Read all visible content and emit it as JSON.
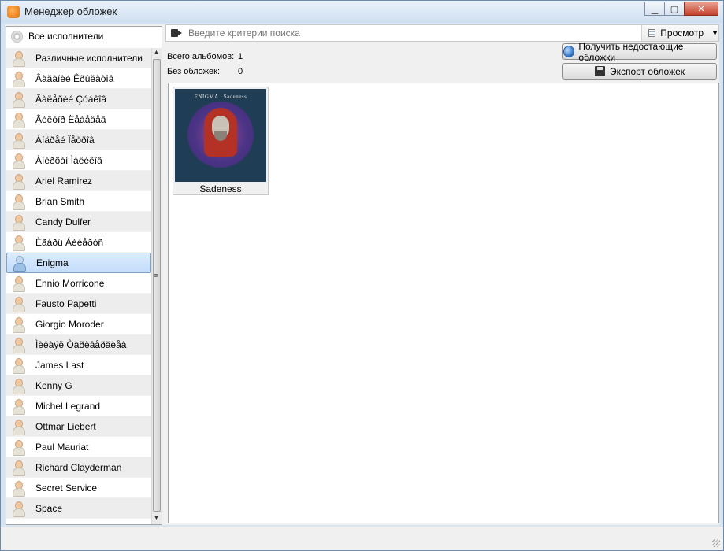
{
  "window": {
    "title": "Менеджер обложек",
    "buttons": {
      "minimize": "▁",
      "maximize": "▢",
      "close": "✕"
    }
  },
  "sidebar": {
    "all_artists_label": "Все исполнители",
    "artists": [
      "Различные исполнители",
      "Âàäàíèé Êðûëàòîâ",
      "Âàëåðèé Çóáêîâ",
      "Âèêòîð Ëåáåäåâ",
      "Àíäðåé Ïåòðîâ",
      "Àìèðõàí Ìàëèêîâ",
      "Ariel Ramirez",
      "Brian Smith",
      "Candy Dulfer",
      "Èãàðü Áèéåðòñ",
      "Enigma",
      "Ennio Morricone",
      "Fausto Papetti",
      "Giorgio Moroder",
      "Ìèêàýë Òàðèâåðäèåâ",
      "James Last",
      "Kenny G",
      "Michel Legrand",
      "Ottmar Liebert",
      "Paul Mauriat",
      "Richard Clayderman",
      "Secret Service",
      "Space"
    ],
    "selected": "Enigma"
  },
  "search": {
    "placeholder": "Введите критерии поиска",
    "view_label": "Просмотр"
  },
  "stats": {
    "total_albums_label": "Всего альбомов:",
    "total_albums_value": "1",
    "no_covers_label": "Без обложек:",
    "no_covers_value": "0"
  },
  "actions": {
    "fetch_missing_label": "Получить недостающие обложки",
    "export_label": "Экспорт обложек"
  },
  "albums": [
    {
      "title": "Sadeness",
      "cover_text": "ENIGMA | Sadeness"
    }
  ],
  "icons": {
    "app": "app-icon",
    "all_artists": "disc-icon",
    "artist": "person-icon",
    "search": "search-icon",
    "view": "view-list-icon",
    "fetch": "globe-icon",
    "export": "save-icon"
  }
}
